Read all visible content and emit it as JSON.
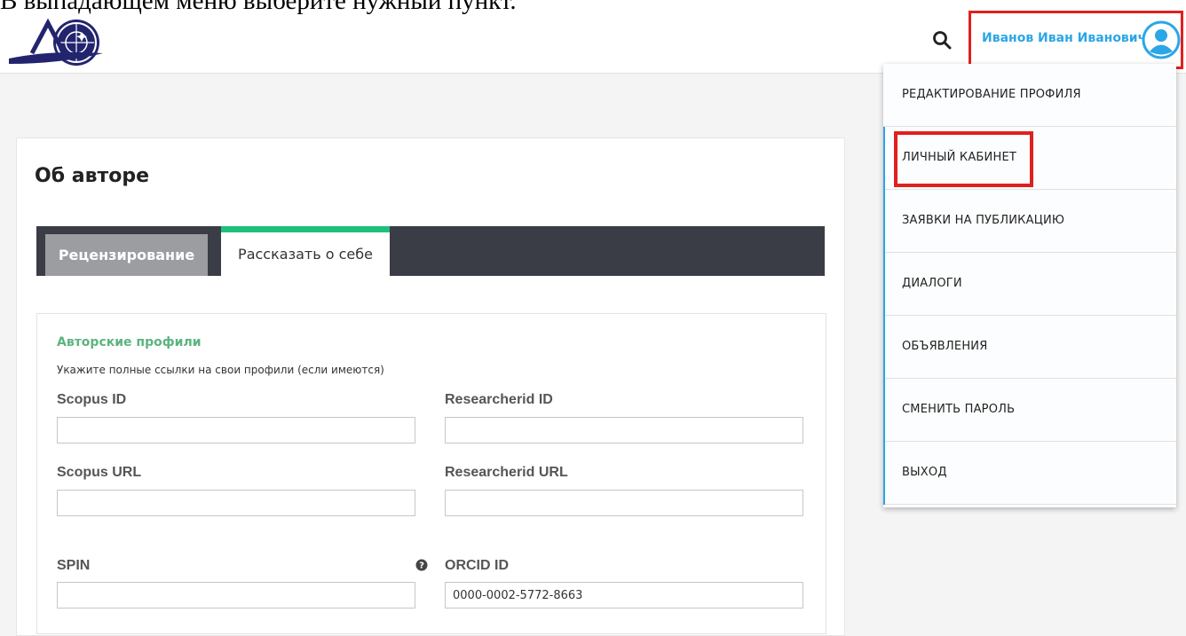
{
  "caption": "В выпадающем меню выберите нужный пункт.",
  "header": {
    "user_name": "Иванов Иван Иванович",
    "search_icon": "search-icon",
    "avatar_icon": "user-avatar-icon",
    "accent_color": "#2ba6e6",
    "highlight_color": "#e0201e"
  },
  "page": {
    "title": "Об авторе",
    "tabs": [
      {
        "label": "Рецензирование"
      },
      {
        "label": "Рассказать о себе"
      }
    ],
    "active_tab_color": "#1ec07a"
  },
  "form": {
    "section_title": "Авторские профили",
    "section_hint": "Укажите полные ссылки на свои профили (если имеются)",
    "fields": [
      {
        "label": "Scopus ID",
        "value": ""
      },
      {
        "label": "Researcherid ID",
        "value": ""
      },
      {
        "label": "Scopus URL",
        "value": ""
      },
      {
        "label": "Researcherid URL",
        "value": ""
      },
      {
        "label": "SPIN",
        "value": ""
      },
      {
        "label": "ORCID ID",
        "value": "0000-0002-5772-8663"
      }
    ],
    "help_icon": "question-circle-icon"
  },
  "menu": {
    "items": [
      {
        "label": "РЕДАКТИРОВАНИЕ ПРОФИЛЯ"
      },
      {
        "label": "ЛИЧНЫЙ КАБИНЕТ"
      },
      {
        "label": "ЗАЯВКИ НА ПУБЛИКАЦИЮ"
      },
      {
        "label": "ДИАЛОГИ"
      },
      {
        "label": "ОБЪЯВЛЕНИЯ"
      },
      {
        "label": "СМЕНИТЬ ПАРОЛЬ"
      },
      {
        "label": "ВЫХОД"
      }
    ]
  }
}
